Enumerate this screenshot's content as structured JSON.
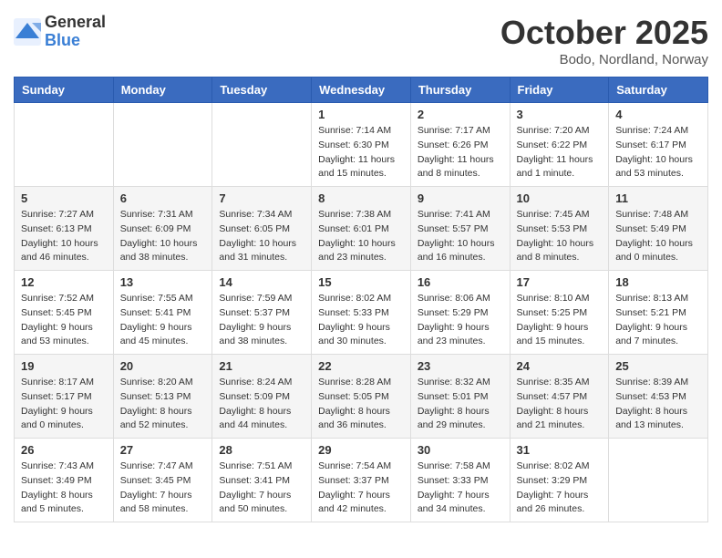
{
  "header": {
    "logo_general": "General",
    "logo_blue": "Blue",
    "month": "October 2025",
    "location": "Bodo, Nordland, Norway"
  },
  "weekdays": [
    "Sunday",
    "Monday",
    "Tuesday",
    "Wednesday",
    "Thursday",
    "Friday",
    "Saturday"
  ],
  "weeks": [
    [
      {
        "day": "",
        "info": ""
      },
      {
        "day": "",
        "info": ""
      },
      {
        "day": "",
        "info": ""
      },
      {
        "day": "1",
        "info": "Sunrise: 7:14 AM\nSunset: 6:30 PM\nDaylight: 11 hours\nand 15 minutes."
      },
      {
        "day": "2",
        "info": "Sunrise: 7:17 AM\nSunset: 6:26 PM\nDaylight: 11 hours\nand 8 minutes."
      },
      {
        "day": "3",
        "info": "Sunrise: 7:20 AM\nSunset: 6:22 PM\nDaylight: 11 hours\nand 1 minute."
      },
      {
        "day": "4",
        "info": "Sunrise: 7:24 AM\nSunset: 6:17 PM\nDaylight: 10 hours\nand 53 minutes."
      }
    ],
    [
      {
        "day": "5",
        "info": "Sunrise: 7:27 AM\nSunset: 6:13 PM\nDaylight: 10 hours\nand 46 minutes."
      },
      {
        "day": "6",
        "info": "Sunrise: 7:31 AM\nSunset: 6:09 PM\nDaylight: 10 hours\nand 38 minutes."
      },
      {
        "day": "7",
        "info": "Sunrise: 7:34 AM\nSunset: 6:05 PM\nDaylight: 10 hours\nand 31 minutes."
      },
      {
        "day": "8",
        "info": "Sunrise: 7:38 AM\nSunset: 6:01 PM\nDaylight: 10 hours\nand 23 minutes."
      },
      {
        "day": "9",
        "info": "Sunrise: 7:41 AM\nSunset: 5:57 PM\nDaylight: 10 hours\nand 16 minutes."
      },
      {
        "day": "10",
        "info": "Sunrise: 7:45 AM\nSunset: 5:53 PM\nDaylight: 10 hours\nand 8 minutes."
      },
      {
        "day": "11",
        "info": "Sunrise: 7:48 AM\nSunset: 5:49 PM\nDaylight: 10 hours\nand 0 minutes."
      }
    ],
    [
      {
        "day": "12",
        "info": "Sunrise: 7:52 AM\nSunset: 5:45 PM\nDaylight: 9 hours\nand 53 minutes."
      },
      {
        "day": "13",
        "info": "Sunrise: 7:55 AM\nSunset: 5:41 PM\nDaylight: 9 hours\nand 45 minutes."
      },
      {
        "day": "14",
        "info": "Sunrise: 7:59 AM\nSunset: 5:37 PM\nDaylight: 9 hours\nand 38 minutes."
      },
      {
        "day": "15",
        "info": "Sunrise: 8:02 AM\nSunset: 5:33 PM\nDaylight: 9 hours\nand 30 minutes."
      },
      {
        "day": "16",
        "info": "Sunrise: 8:06 AM\nSunset: 5:29 PM\nDaylight: 9 hours\nand 23 minutes."
      },
      {
        "day": "17",
        "info": "Sunrise: 8:10 AM\nSunset: 5:25 PM\nDaylight: 9 hours\nand 15 minutes."
      },
      {
        "day": "18",
        "info": "Sunrise: 8:13 AM\nSunset: 5:21 PM\nDaylight: 9 hours\nand 7 minutes."
      }
    ],
    [
      {
        "day": "19",
        "info": "Sunrise: 8:17 AM\nSunset: 5:17 PM\nDaylight: 9 hours\nand 0 minutes."
      },
      {
        "day": "20",
        "info": "Sunrise: 8:20 AM\nSunset: 5:13 PM\nDaylight: 8 hours\nand 52 minutes."
      },
      {
        "day": "21",
        "info": "Sunrise: 8:24 AM\nSunset: 5:09 PM\nDaylight: 8 hours\nand 44 minutes."
      },
      {
        "day": "22",
        "info": "Sunrise: 8:28 AM\nSunset: 5:05 PM\nDaylight: 8 hours\nand 36 minutes."
      },
      {
        "day": "23",
        "info": "Sunrise: 8:32 AM\nSunset: 5:01 PM\nDaylight: 8 hours\nand 29 minutes."
      },
      {
        "day": "24",
        "info": "Sunrise: 8:35 AM\nSunset: 4:57 PM\nDaylight: 8 hours\nand 21 minutes."
      },
      {
        "day": "25",
        "info": "Sunrise: 8:39 AM\nSunset: 4:53 PM\nDaylight: 8 hours\nand 13 minutes."
      }
    ],
    [
      {
        "day": "26",
        "info": "Sunrise: 7:43 AM\nSunset: 3:49 PM\nDaylight: 8 hours\nand 5 minutes."
      },
      {
        "day": "27",
        "info": "Sunrise: 7:47 AM\nSunset: 3:45 PM\nDaylight: 7 hours\nand 58 minutes."
      },
      {
        "day": "28",
        "info": "Sunrise: 7:51 AM\nSunset: 3:41 PM\nDaylight: 7 hours\nand 50 minutes."
      },
      {
        "day": "29",
        "info": "Sunrise: 7:54 AM\nSunset: 3:37 PM\nDaylight: 7 hours\nand 42 minutes."
      },
      {
        "day": "30",
        "info": "Sunrise: 7:58 AM\nSunset: 3:33 PM\nDaylight: 7 hours\nand 34 minutes."
      },
      {
        "day": "31",
        "info": "Sunrise: 8:02 AM\nSunset: 3:29 PM\nDaylight: 7 hours\nand 26 minutes."
      },
      {
        "day": "",
        "info": ""
      }
    ]
  ]
}
